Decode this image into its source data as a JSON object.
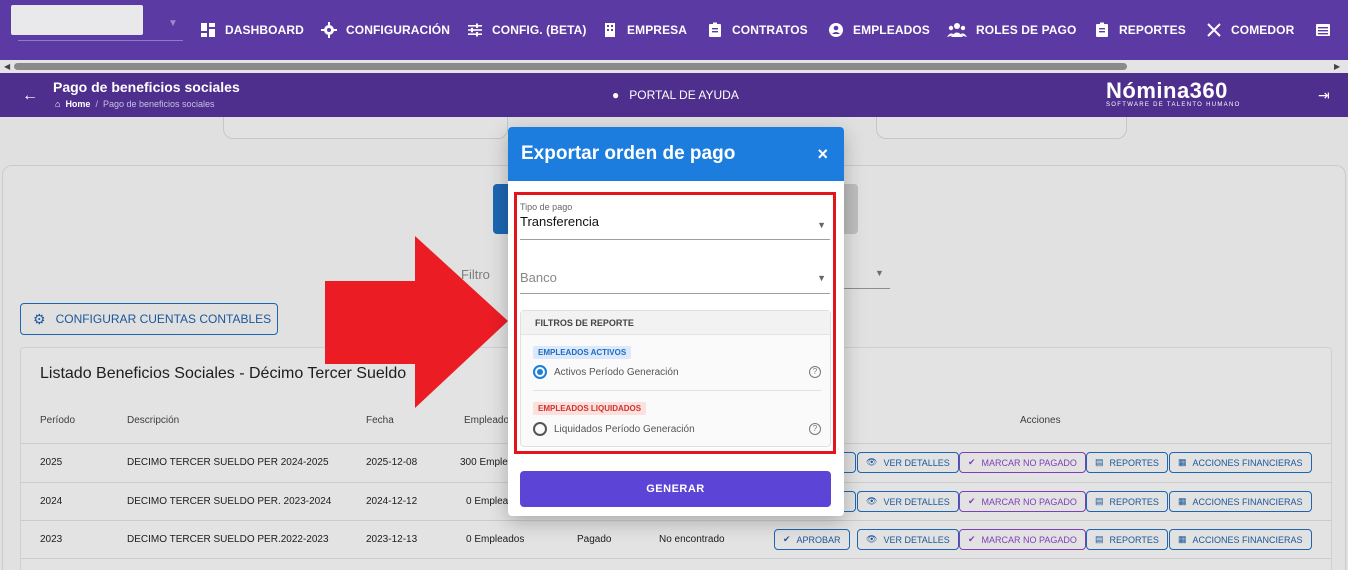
{
  "nav": {
    "items": [
      {
        "label": "DASHBOARD",
        "icon": "dashboard-icon"
      },
      {
        "label": "CONFIGURACIÓN",
        "icon": "gear-icon"
      },
      {
        "label": "CONFIG. (BETA)",
        "icon": "tune-icon"
      },
      {
        "label": "EMPRESA",
        "icon": "building-icon"
      },
      {
        "label": "CONTRATOS",
        "icon": "contract-icon"
      },
      {
        "label": "EMPLEADOS",
        "icon": "employees-icon"
      },
      {
        "label": "ROLES DE PAGO",
        "icon": "people-icon"
      },
      {
        "label": "REPORTES",
        "icon": "report-icon"
      },
      {
        "label": "COMEDOR",
        "icon": "cutlery-icon"
      }
    ]
  },
  "subheader": {
    "title": "Pago de beneficios sociales",
    "breadcrumb_home": "Home",
    "breadcrumb_sep": "/",
    "breadcrumb_current": "Pago de beneficios sociales",
    "help_label": "PORTAL DE AYUDA",
    "brand_name": "Nómina360",
    "brand_tagline": "SOFTWARE DE TALENTO HUMANO"
  },
  "page": {
    "filter_label": "Filtro",
    "config_button": "CONFIGURAR CUENTAS CONTABLES",
    "list_title": "Listado Beneficios Sociales - Décimo Tercer Sueldo",
    "columns": [
      "Período",
      "Descripción",
      "Fecha",
      "Empleado",
      "Acciones"
    ],
    "rows": [
      {
        "periodo": "2025",
        "descripcion": "DECIMO TERCER SUELDO PER 2024-2025",
        "fecha": "2025-12-08",
        "empleados": "300 Emple",
        "estado": "",
        "archivo": ""
      },
      {
        "periodo": "2024",
        "descripcion": "DECIMO TERCER SUELDO PER. 2023-2024",
        "fecha": "2024-12-12",
        "empleados": "0 Emplea",
        "estado": "",
        "archivo": ""
      },
      {
        "periodo": "2023",
        "descripcion": "DECIMO TERCER SUELDO PER.2022-2023",
        "fecha": "2023-12-13",
        "empleados": "0 Empleados",
        "estado": "Pagado",
        "archivo": "No encontrado"
      }
    ],
    "actions": {
      "aprobar": "APROBAR",
      "ver_detalles": "VER DETALLES",
      "marcar_no_pagado": "MARCAR NO PAGADO",
      "reportes": "REPORTES",
      "acciones_financieras": "ACCIONES FINANCIERAS"
    }
  },
  "modal": {
    "title": "Exportar orden de pago",
    "close": "×",
    "tipo_pago_label": "Tipo de pago",
    "tipo_pago_value": "Transferencia",
    "banco_placeholder": "Banco",
    "filters_title": "FILTROS DE REPORTE",
    "activos_tag": "EMPLEADOS ACTIVOS",
    "activos_option": "Activos Período Generación",
    "liquidados_tag": "EMPLEADOS LIQUIDADOS",
    "liquidados_option": "Liquidados Período Generación",
    "help_mark": "?",
    "generate_button": "GENERAR"
  },
  "colors": {
    "topnav": "#5b3aa3",
    "subheader": "#4e2f8d",
    "modal_header": "#1c7ddf",
    "highlight": "#e3141c",
    "generate": "#5c45d6"
  }
}
